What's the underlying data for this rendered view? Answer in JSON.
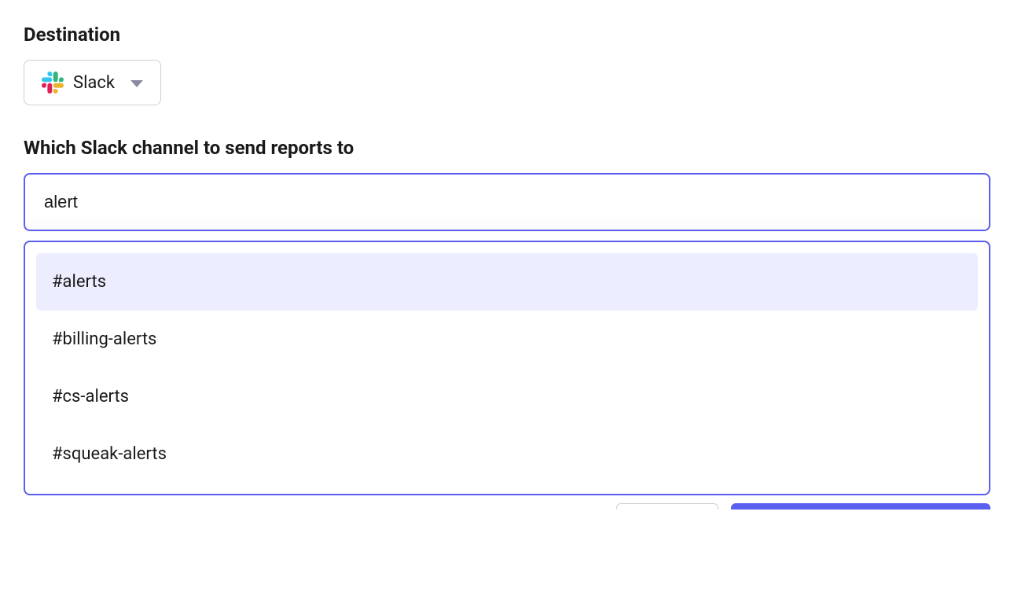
{
  "destination": {
    "section_label": "Destination",
    "selected_label": "Slack"
  },
  "channel": {
    "field_label": "Which Slack channel to send reports to",
    "search_value": "alert",
    "options": [
      {
        "label": "#alerts",
        "highlighted": true
      },
      {
        "label": "#billing-alerts",
        "highlighted": false
      },
      {
        "label": "#cs-alerts",
        "highlighted": false
      },
      {
        "label": "#squeak-alerts",
        "highlighted": false
      }
    ]
  },
  "colors": {
    "accent": "#5b5fef",
    "highlight_bg": "#ecedff"
  }
}
